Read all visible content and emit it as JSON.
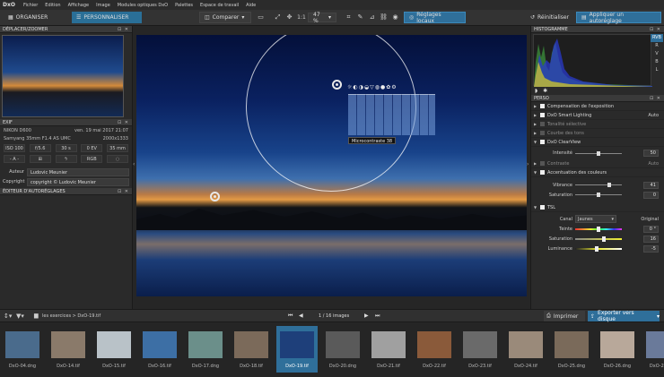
{
  "app": {
    "logo": "DxO"
  },
  "menu": [
    "Fichier",
    "Edition",
    "Affichage",
    "Image",
    "Modules optiques DxO",
    "Palettes",
    "Espace de travail",
    "Aide"
  ],
  "toolbar": {
    "organize_label": "ORGANISER",
    "customize_label": "PERSONNALISER",
    "compare_label": "Comparer",
    "ratio_label": "1:1",
    "zoom_value": "47 %",
    "local_adjust_label": "Réglages locaux",
    "reset_label": "Réinitialiser",
    "apply_preset_label": "Appliquer un autoréglage"
  },
  "left": {
    "navigator_title": "DÉPLACER/ZOOMER",
    "exif_title": "EXIF",
    "exif": {
      "camera": "NIKON D600",
      "date": "ven. 19 mai 2017 21:07",
      "lens": "Samyang 35mm F1.4 AS UMC",
      "dimensions": "2000x1333",
      "iso": "ISO 100",
      "aperture": "f/5.6",
      "shutter": "30 s",
      "ev": "0 EV",
      "focal": "35 mm",
      "mode": "- A -",
      "colorspace": "RGB"
    },
    "author_label": "Auteur",
    "author_value": "Ludovic Meunier",
    "copyright_label": "Copyright",
    "copyright_value": "copyright © Ludovic Meunier",
    "presets_title": "ÉDITEUR D'AUTORÉGLAGES"
  },
  "viewer": {
    "tooltip": "Microcontraste 38"
  },
  "right": {
    "histogram_title": "HISTOGRAMME",
    "histogram_tabs": [
      "RVB",
      "R",
      "V",
      "B",
      "L"
    ],
    "perso_title": "PERSO",
    "rows": {
      "exposure": "Compensation de l'exposition",
      "smart_lighting": "DxO Smart Lighting",
      "smart_lighting_value": "Auto",
      "selective_tone": "Tonalité sélective",
      "tone_curve": "Courbe des tons",
      "clearview": "DxO ClearView",
      "contrast": "Contraste",
      "contrast_value": "Auto",
      "color_accent": "Accentuation des couleurs",
      "hsl": "TSL"
    },
    "clearview_intensity_label": "Intensité",
    "clearview_intensity_value": "50",
    "vibrance_label": "Vibrance",
    "vibrance_value": "41",
    "saturation_label": "Saturation",
    "saturation_value": "0",
    "hsl_channel_label": "Canal",
    "hsl_channel_value": "Jaunes",
    "hsl_original_label": "Original",
    "hsl_hue_label": "Teinte",
    "hsl_hue_value": "0 °",
    "hsl_sat_label": "Saturation",
    "hsl_sat_value": "16",
    "hsl_lum_label": "Luminance",
    "hsl_lum_value": "-5"
  },
  "bottom": {
    "breadcrumb": "les exercices > DxO-19.tif",
    "page_counter": "1 / 16 images",
    "print_label": "Imprimer",
    "export_label": "Exporter vers disque"
  },
  "filmstrip": [
    {
      "name": "DxO-04.dng",
      "color": "#4a6b8c"
    },
    {
      "name": "DxO-14.tif",
      "color": "#8a7a6a"
    },
    {
      "name": "DxO-15.tif",
      "color": "#b9c2c8"
    },
    {
      "name": "DxO-16.tif",
      "color": "#3d6fa5"
    },
    {
      "name": "DxO-17.dng",
      "color": "#6b8f8a"
    },
    {
      "name": "DxO-18.tif",
      "color": "#7b6a5a"
    },
    {
      "name": "DxO-19.tif",
      "color": "#1e3f7a",
      "selected": true
    },
    {
      "name": "DxO-20.dng",
      "color": "#5a5a5a"
    },
    {
      "name": "DxO-21.tif",
      "color": "#a0a0a0"
    },
    {
      "name": "DxO-22.tif",
      "color": "#8a5a3a"
    },
    {
      "name": "DxO-23.tif",
      "color": "#6a6a6a"
    },
    {
      "name": "DxO-24.tif",
      "color": "#9a8a7a"
    },
    {
      "name": "DxO-25.dng",
      "color": "#7a6a5a"
    },
    {
      "name": "DxO-26.dng",
      "color": "#b8a89a"
    },
    {
      "name": "DxO-28.dng",
      "color": "#6a7a9a"
    }
  ]
}
